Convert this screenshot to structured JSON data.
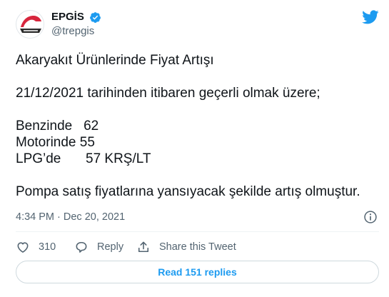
{
  "account": {
    "display_name": "EPGİS",
    "handle": "@trepgis",
    "verified": true
  },
  "tweet": {
    "title_line": "Akaryakıt Ürünlerinde Fiyat Artışı",
    "date_line": "21/12/2021 tarihinden itibaren geçerli olmak üzere;",
    "prices": [
      {
        "label": "Benzinde",
        "value": "62"
      },
      {
        "label": "Motorinde",
        "value": "55"
      },
      {
        "label": "LPG’de",
        "value": "57 KRŞ/LT"
      }
    ],
    "closing_line": "Pompa satış fiyatlarına yansıyacak şekilde artış olmuştur."
  },
  "meta": {
    "timestamp": "4:34 PM · Dec 20, 2021"
  },
  "actions": {
    "like_count": "310",
    "reply_label": "Reply",
    "share_label": "Share this Tweet"
  },
  "replies_button": {
    "label": "Read 151 replies"
  },
  "colors": {
    "twitter_blue": "#1d9bf0",
    "text_primary": "#0f1419",
    "text_secondary": "#536471",
    "logo_red": "#d7263d"
  },
  "icons": {
    "avatar": "epgis-logo",
    "verified": "verified-badge-icon",
    "brand": "twitter-bird-icon",
    "info": "info-icon",
    "like": "heart-icon",
    "reply": "reply-bubble-icon",
    "share": "share-icon"
  }
}
